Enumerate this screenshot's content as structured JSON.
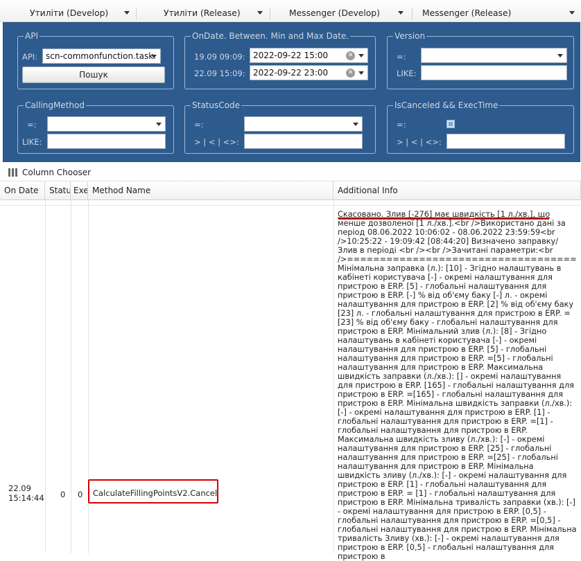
{
  "menu": [
    {
      "label": "Утиліти (Develop)"
    },
    {
      "label": "Утиліти (Release)"
    },
    {
      "label": "Messenger (Develop)"
    },
    {
      "label": "Messenger (Release)"
    }
  ],
  "filters": {
    "api": {
      "legend": "API",
      "label": "API:",
      "value": "scn-commonfunction.task.",
      "search_button": "Пошук"
    },
    "ondate": {
      "legend": "OnDate. Between. Min and Max Date.",
      "min_label": "19.09 09:09:",
      "min_value": "2022-09-22 15:00",
      "max_label": "22.09 15:09:",
      "max_value": "2022-09-22 23:00"
    },
    "version": {
      "legend": "Version",
      "eq_label": "=:",
      "eq_value": "",
      "like_label": "LIKE:",
      "like_value": ""
    },
    "calling_method": {
      "legend": "CallingMethod",
      "eq_label": "=:",
      "eq_value": "",
      "like_label": "LIKE:",
      "like_value": ""
    },
    "status_code": {
      "legend": "StatusCode",
      "eq_label": "=:",
      "eq_value": "",
      "cmp_label": "> | < | <>:",
      "cmp_value": ""
    },
    "is_canceled": {
      "legend": "IsCanceled && ExecTime",
      "eq_label": "=:",
      "cmp_label": "> | < | <>:",
      "cmp_value": ""
    }
  },
  "grid": {
    "column_chooser": "Column Chooser",
    "columns": [
      "On Date",
      "Status",
      "Exec",
      "Method Name",
      "Additional Info"
    ],
    "rows": [
      {
        "on_date": "22.09",
        "on_time": "15:14:44",
        "status": "0",
        "exec": "0",
        "method": "CalculateFillingPointsV2.Cancel",
        "info_highlight": "Скасовано. Злив [-276] має швидкість [1 л./хв.], що",
        "info_rest": "менше дозволеної [1 л./хв.].<br />Використано дані за період 08.06.2022 10:06:02 - 08.06.2022 23:59:59<br />10:25:22 - 19:09:42 [08:44:20] Визначено заправку/Злив в періоді <br /><br />Зачитані параметри:<br />=================================== Мінімальна заправка (л.): [10] - Згідно налаштувань в кабінеті користувача [-] - окремі налаштування для пристрою в ERP. [5] - глобальні налаштування для пристрою в ERP. [-] % від об'єму баку [-] л. - окремі налаштування для пристрою в ERP. [2] % від об'єму баку [23] л. - глобальні налаштування для пристрою в ERP. = [23] % від об'єму баку - глобальні налаштування для пристрою в ERP. Мінімальний злив (л.): [8] - Згідно налаштувань в кабінеті користувача [-] - окремі налаштування для пристрою в ERP. [5] - глобальні налаштування для пристрою в ERP. =[5] - глобальні налаштування для пристрою в ERP. Максимальна швидкість заправки (л./хв.): [] - окремі налаштування для пристрою в ERP. [165] - глобальні налаштування для пристрою в ERP. =[165] - глобальні налаштування для пристрою в ERP. Мінімальна швидкість заправки (л./хв.): [-] - окремі налаштування для пристрою в ERP. [1] - глобальні налаштування для пристрою в ERP. =[1] - глобальні налаштування для пристрою в ERP. Максимальна швидкість зливу (л./хв.): [-] - окремі налаштування для пристрою в ERP. [25] - глобальні налаштування для пристрою в ERP. =[25] - глобальні налаштування для пристрою в ERP. Мінімальна швидкість зливу (л./хв.): [-] - окремі налаштування для пристрою в ERP. [1] - глобальні налаштування для пристрою в ERP. = [1] - глобальні налаштування для пристрою в ERP. Мінімальна тривалість заправки (хв.): [-] - окремі налаштування для пристрою в ERP. [0,5] - глобальні налаштування для пристрою в ERP. =[0,5] - глобальні налаштування для пристрою в ERP. Мінімальна тривалість Зливу (хв.): [-] - окремі налаштування для пристрою в ERP. [0,5] - глобальні налаштування для пристрою в"
      }
    ]
  }
}
